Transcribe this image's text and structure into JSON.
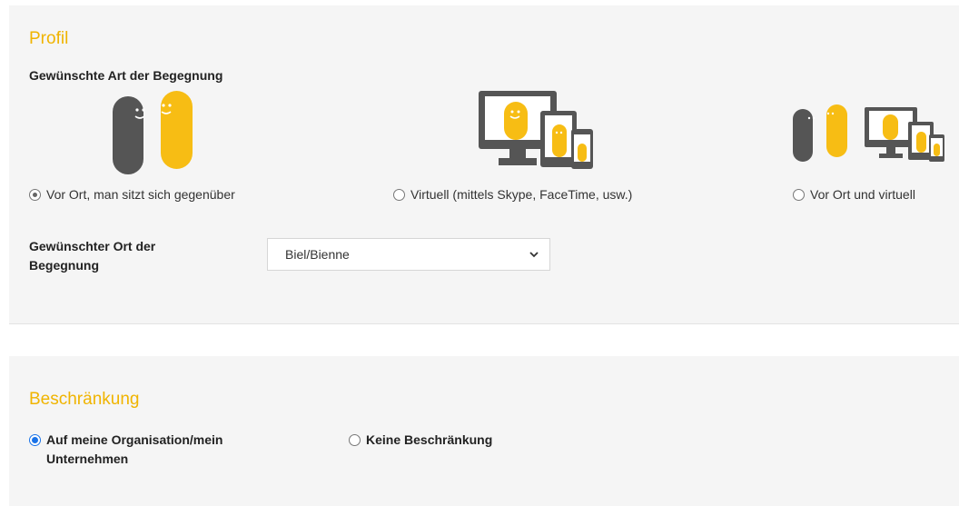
{
  "profil": {
    "title": "Profil",
    "encounter_type_label": "Gewünschte Art der Begegnung",
    "options": [
      {
        "label": "Vor Ort, man sitzt sich gegenüber",
        "checked": true
      },
      {
        "label": "Virtuell (mittels Skype, FaceTime, usw.)",
        "checked": false
      },
      {
        "label": "Vor Ort und virtuell",
        "checked": false
      }
    ],
    "location_label": "Gewünschter Ort der Begegnung",
    "location_value": "Biel/Bienne"
  },
  "restriction": {
    "title": "Beschränkung",
    "options": [
      {
        "label": "Auf meine Organisation/mein Unternehmen",
        "checked": true
      },
      {
        "label": "Keine Beschränkung",
        "checked": false
      }
    ]
  },
  "colors": {
    "accent": "#f0b400",
    "figure_grey": "#555555",
    "figure_yellow": "#f7bd14",
    "radio_blue": "#1a73e8"
  }
}
